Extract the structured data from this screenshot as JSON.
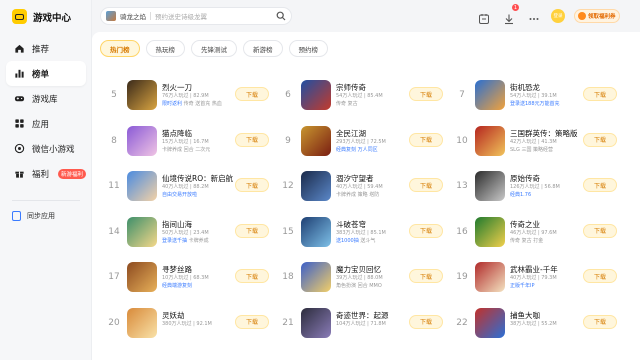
{
  "app": {
    "title": "游戏中心"
  },
  "sidebar": {
    "items": [
      {
        "label": "推荐",
        "icon": "home-icon",
        "active": false
      },
      {
        "label": "榜单",
        "icon": "chart-icon",
        "active": true
      },
      {
        "label": "游戏库",
        "icon": "gamepad-icon",
        "active": false
      },
      {
        "label": "应用",
        "icon": "grid-icon",
        "active": false
      },
      {
        "label": "微信小游戏",
        "icon": "wechat-icon",
        "active": false
      },
      {
        "label": "福利",
        "icon": "gift-icon",
        "active": false,
        "badge": "新游福利"
      }
    ],
    "sync_label": "同步应用"
  },
  "search": {
    "game": "骑龙之焰",
    "placeholder": "预约送史诗级龙翼"
  },
  "header": {
    "download_badge": "1",
    "avatar_text": "登录",
    "welfare_label": "领取福利券"
  },
  "tabs": [
    {
      "label": "热门榜",
      "active": true
    },
    {
      "label": "热玩榜",
      "active": false
    },
    {
      "label": "先锋测试",
      "active": false
    },
    {
      "label": "新游榜",
      "active": false
    },
    {
      "label": "预约榜",
      "active": false
    }
  ],
  "download_label": "下载",
  "games": [
    {
      "rank": "5",
      "name": "烈火一刀",
      "meta": "76万人玩过 | 82.9M",
      "tags": [
        "传奇",
        "送首充",
        "热血"
      ],
      "hl": "限时返利",
      "colors": [
        "#3a2a1a",
        "#d9a441"
      ]
    },
    {
      "rank": "6",
      "name": "宗师传奇",
      "meta": "54万人玩过 | 85.4M",
      "tags": [
        "传奇",
        "复古"
      ],
      "hl": "",
      "colors": [
        "#1f4fa3",
        "#c33a2b"
      ]
    },
    {
      "rank": "7",
      "name": "街机恐龙",
      "meta": "54万人玩过 | 39.1M",
      "tags": [],
      "hl": "登录送188元万能首充",
      "colors": [
        "#2a6fd1",
        "#f2a23b"
      ]
    },
    {
      "rank": "8",
      "name": "猫点降临",
      "meta": "15万人玩过 | 16.7M",
      "tags": [
        "卡牌养成",
        "回合",
        "二次元"
      ],
      "hl": "",
      "colors": [
        "#8a5ad6",
        "#f0c4e4"
      ]
    },
    {
      "rank": "9",
      "name": "全民江湖",
      "meta": "293万人玩过 | 72.5M",
      "tags": [],
      "hl": "经典复刻 万人同区",
      "colors": [
        "#c8962f",
        "#7a1e12"
      ]
    },
    {
      "rank": "10",
      "name": "三国群英传：策略版",
      "meta": "42万人玩过 | 41.3M",
      "tags": [
        "SLG",
        "三国",
        "策略经营"
      ],
      "hl": "",
      "colors": [
        "#b5251f",
        "#f1c45b"
      ]
    },
    {
      "rank": "11",
      "name": "仙境传说RO：新启航",
      "meta": "40万人玩过 | 88.2M",
      "tags": [],
      "hl": "自由交易开放啦",
      "colors": [
        "#4a8be0",
        "#f4d2a6"
      ]
    },
    {
      "rank": "12",
      "name": "涸汐守望者",
      "meta": "40万人玩过 | 59.4M",
      "tags": [
        "卡牌养成",
        "策略",
        "塔防"
      ],
      "hl": "",
      "colors": [
        "#1a2a4a",
        "#5b88c9"
      ]
    },
    {
      "rank": "13",
      "name": "原始传奇",
      "meta": "126万人玩过 | 56.8M",
      "tags": [],
      "hl": "经典1.76",
      "colors": [
        "#2b2b2b",
        "#c9c9c9"
      ]
    },
    {
      "rank": "14",
      "name": "指间山海",
      "meta": "50万人玩过 | 23.4M",
      "tags": [
        "卡牌养成"
      ],
      "hl": "登录送千抽",
      "colors": [
        "#3d8f6a",
        "#f5d88a"
      ]
    },
    {
      "rank": "15",
      "name": "斗破苍穹",
      "meta": "383万人玩过 | 85.1M",
      "tags": [
        "送斗气"
      ],
      "hl": "送1000抽",
      "colors": [
        "#1e3f73",
        "#7ec0e8"
      ]
    },
    {
      "rank": "16",
      "name": "传奇之业",
      "meta": "46万人玩过 | 97.6M",
      "tags": [
        "传奇",
        "复古",
        "打金"
      ],
      "hl": "",
      "colors": [
        "#1f7a2e",
        "#f2d04b"
      ]
    },
    {
      "rank": "17",
      "name": "寻梦丝路",
      "meta": "10万人玩过 | 68.3M",
      "tags": [],
      "hl": "经典端游复刻",
      "colors": [
        "#8c4a1f",
        "#e8b15a"
      ]
    },
    {
      "rank": "18",
      "name": "魔力宝贝回忆",
      "meta": "39万人玩过 | 88.0M",
      "tags": [
        "角色扮演",
        "回合",
        "MMO"
      ],
      "hl": "",
      "colors": [
        "#3b5fc9",
        "#f2cf68"
      ]
    },
    {
      "rank": "19",
      "name": "武林霸业-千年",
      "meta": "40万人玩过 | 79.3M",
      "tags": [],
      "hl": "正版千年IP",
      "colors": [
        "#b02a2a",
        "#f4e3c1"
      ]
    },
    {
      "rank": "20",
      "name": "灵妖劫",
      "meta": "380万人玩过 | 92.1M",
      "tags": [],
      "hl": "",
      "colors": [
        "#d88a3a",
        "#f9e2a8"
      ]
    },
    {
      "rank": "21",
      "name": "奇迹世界：起源",
      "meta": "104万人玩过 | 71.8M",
      "tags": [],
      "hl": "",
      "colors": [
        "#2c2c3c",
        "#8a7cb8"
      ]
    },
    {
      "rank": "22",
      "name": "捕鱼大咖",
      "meta": "38万人玩过 | 55.2M",
      "tags": [],
      "hl": "",
      "colors": [
        "#c2312a",
        "#2b6fd6"
      ]
    }
  ]
}
